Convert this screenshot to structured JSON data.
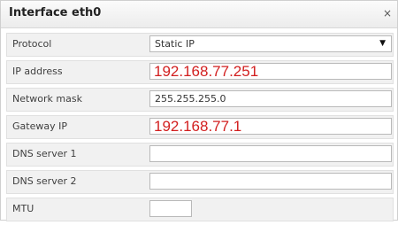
{
  "dialog": {
    "title": "Interface eth0",
    "close_glyph": "×"
  },
  "fields": {
    "protocol": {
      "label": "Protocol",
      "value": "Static IP",
      "caret": "▼"
    },
    "ip_address": {
      "label": "IP address",
      "value": "192.168.77.251"
    },
    "network_mask": {
      "label": "Network mask",
      "value": "255.255.255.0"
    },
    "gateway_ip": {
      "label": "Gateway IP",
      "value": "192.168.77.1"
    },
    "dns_server_1": {
      "label": "DNS server 1",
      "value": ""
    },
    "dns_server_2": {
      "label": "DNS server 2",
      "value": ""
    },
    "mtu": {
      "label": "MTU",
      "value": ""
    }
  },
  "colors": {
    "annotation_red": "#d21f1f",
    "row_background": "#f1f1f1"
  }
}
